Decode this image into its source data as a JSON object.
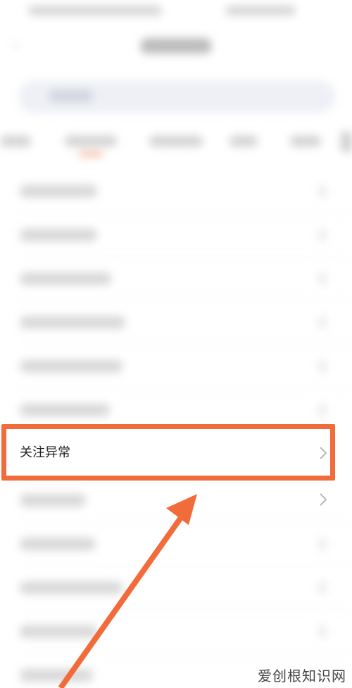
{
  "highlighted_item": {
    "label": "关注异常",
    "icon": "chevron-right-icon"
  },
  "next_item": {
    "icon": "chevron-right-icon"
  },
  "annotation": {
    "box_color": "#f26b3a",
    "arrow_color": "#f26b3a"
  },
  "watermark": {
    "text": "爱创根知识网"
  }
}
